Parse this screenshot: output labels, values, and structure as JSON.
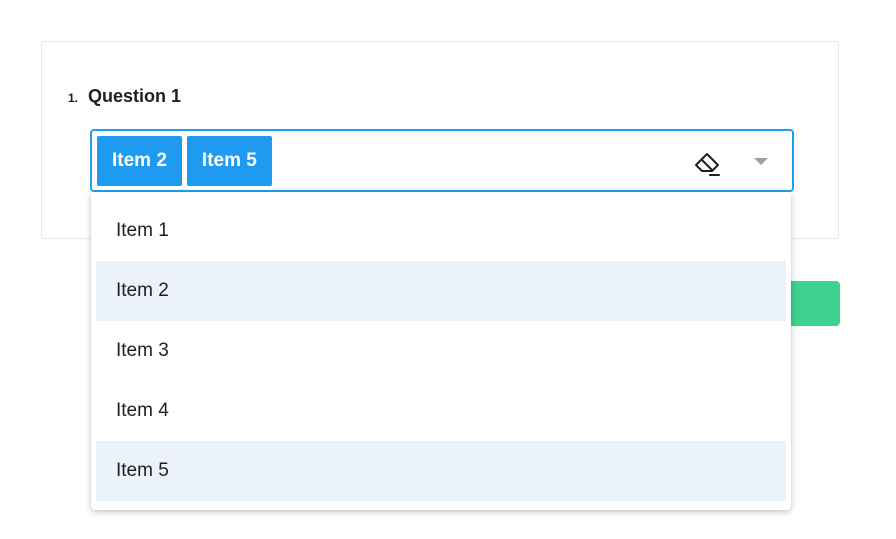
{
  "question": {
    "number": "1.",
    "title": "Question 1"
  },
  "tagbox": {
    "tags": [
      "Item 2",
      "Item 5"
    ]
  },
  "dropdown": {
    "items": [
      {
        "label": "Item 1",
        "selected": false
      },
      {
        "label": "Item 2",
        "selected": true
      },
      {
        "label": "Item 3",
        "selected": false
      },
      {
        "label": "Item 4",
        "selected": false
      },
      {
        "label": "Item 5",
        "selected": true
      }
    ]
  },
  "icons": {
    "clear": "eraser-icon",
    "expand": "chevron-down-icon"
  },
  "colors": {
    "accent": "#1e9bf0",
    "focus_border": "#21a0ef",
    "selected_bg": "#ebf2fa",
    "green_button": "#3dd28f"
  }
}
